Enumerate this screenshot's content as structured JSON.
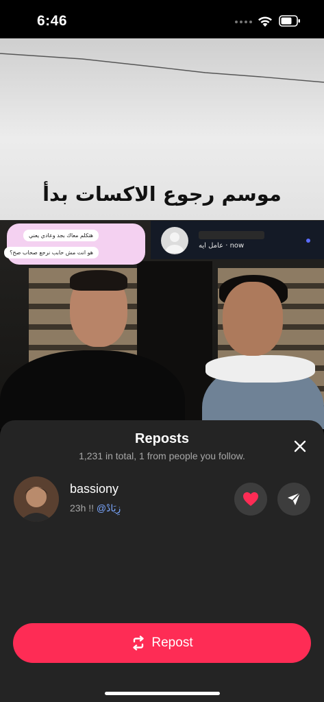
{
  "status_bar": {
    "time": "6:46"
  },
  "photo": {
    "caption": "موسم رجوع الاكسات بدأ",
    "chat_lines": [
      "هتكلم معاك بجد وعادي يعني",
      "هو انت مش حابب نرجع صحاب صح؟"
    ],
    "notification_text": "عامل ايه · now"
  },
  "sheet": {
    "title": "Reposts",
    "subtitle": "1,231 in total, 1 from people you follow."
  },
  "repost_user": {
    "username": "bassiony",
    "time": "23h",
    "text_prefix": "!!",
    "mention": "@زِيَادْ"
  },
  "actions": {
    "repost_label": "Repost"
  },
  "colors": {
    "accent": "#fe2c55",
    "sheet_bg": "#242424",
    "like": "#fe2c55"
  },
  "icons": [
    "wifi-icon",
    "battery-icon",
    "close-icon",
    "heart-icon",
    "send-icon",
    "repost-icon"
  ]
}
